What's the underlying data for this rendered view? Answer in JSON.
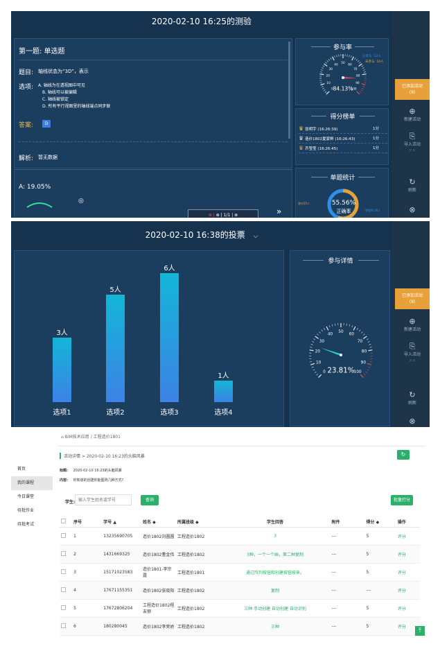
{
  "quiz": {
    "title": "2020-02-10 16:25的测验",
    "question_heading": "第一题: 单选题",
    "question_label": "题目:",
    "question_text": "轴线状态为“3D”，表示",
    "options_label": "选项:",
    "options": [
      "A. 轴线为在透视图中可见",
      "B. 轴线可以被编辑",
      "C. 轴线被锁定",
      "D. 所有平行视图里的轴线端点同步联"
    ],
    "answer_label": "答案:",
    "answer_value": "D",
    "analysis_label": "解析:",
    "analysis_value": "暂无数据",
    "stat_line": "A: 19.05%",
    "pager": "1/1",
    "participation": {
      "title": "参与率",
      "joined": "已参与: 53人",
      "not_joined": "未参与: 10人",
      "rate": "84.13%",
      "rate_value": 84.13,
      "ticks": [
        "0",
        "10",
        "20",
        "30",
        "40",
        "50",
        "60",
        "70",
        "80",
        "90",
        "100"
      ]
    },
    "leaderboard": {
      "title": "得分榜单",
      "rows": [
        {
          "name": "张明宇 (16:26:39)",
          "score": "1分"
        },
        {
          "name": "造价1802夏家鲜 (16:26:43)",
          "score": "1分"
        },
        {
          "name": "齐莹莹 (16:26:45)",
          "score": "1分"
        }
      ]
    },
    "single_stats": {
      "title": "单题统计",
      "left": "答对35人",
      "right": "答错率:26人",
      "percent": "55.56%",
      "percent_value": 55.56,
      "sub": "正确率"
    }
  },
  "rail": {
    "joined_activity": "已添加活动",
    "joined_count": "(9)",
    "new_activity": "新建活动",
    "import_activity": "导入活动",
    "refresh": "刷新",
    "close": "关闭"
  },
  "vote": {
    "title": "2020-02-10 16:38的投票",
    "dropdown_icon": "chevron-down-icon",
    "detail_title": "参与详情",
    "rate": "23.81%",
    "rate_value": 23.81,
    "bars": [
      {
        "label": "选项1",
        "count": "3人",
        "value": 3
      },
      {
        "label": "选项2",
        "count": "5人",
        "value": 5
      },
      {
        "label": "选项3",
        "count": "6人",
        "value": 6
      },
      {
        "label": "选项4",
        "count": "1人",
        "value": 1
      }
    ]
  },
  "chart_data": {
    "type": "bar",
    "categories": [
      "选项1",
      "选项2",
      "选项3",
      "选项4"
    ],
    "values": [
      3,
      5,
      6,
      1
    ],
    "title": "",
    "xlabel": "",
    "ylabel": "",
    "ylim": [
      0,
      6
    ],
    "grid": false
  },
  "web": {
    "breadcrumb_top": "BIM技术应用 / 工程造价1801",
    "side_menu": [
      "首页",
      "我的课程",
      "今日课堂",
      "待批作业",
      "待批考试"
    ],
    "breadcrumb": "活动详情 > 2020-02-10 16:23的头脑风暴",
    "title_label": "标题:",
    "title_value": "2020-02-10 16:23的头脑风暴",
    "content_label": "内容:",
    "content_value": "你知道的创建你能图则几种方式?",
    "student_label": "学生:",
    "search_placeholder": "输入学生姓名或学号",
    "search_button": "查询",
    "batch_button": "批量打分",
    "columns": [
      "序号",
      "学号 ▲",
      "姓名 ◆",
      "所属班级 ◆",
      "学生回答",
      "附件",
      "得分 ◆",
      "操作"
    ],
    "rows": [
      {
        "no": "1",
        "id": "13235690705",
        "name": "造价1802刘圆圆",
        "class": "工程造价1802",
        "answer": "3",
        "att": "---",
        "score": "5",
        "op": "评分"
      },
      {
        "no": "2",
        "id": "1431669325",
        "name": "造价1802董金伟",
        "class": "工程造价1802",
        "answer": "3种，一个一个画，第二种复制",
        "att": "---",
        "score": "5",
        "op": "评分"
      },
      {
        "no": "3",
        "id": "15171023583",
        "name": "造价1801-李宗露",
        "class": "工程造价1801",
        "answer": "通过阵列按钮和创建按钮按来。",
        "att": "---",
        "score": "5",
        "op": "评分"
      },
      {
        "no": "4",
        "id": "17671155351",
        "name": "造价1802张晓阳",
        "class": "工程造价1802",
        "answer": "复制",
        "att": "---",
        "score": "---",
        "op": "评分"
      },
      {
        "no": "5",
        "id": "17672806204",
        "name": "工程造价1802程友丽",
        "class": "工程造价1802",
        "answer": "三种 手动创建 自动创建 自动识别",
        "att": "---",
        "score": "5",
        "op": "评分"
      },
      {
        "no": "6",
        "id": "180280045",
        "name": "造价1802李荣娇",
        "class": "工程造价1802",
        "answer": "三种",
        "att": "---",
        "score": "5",
        "op": "评分"
      }
    ],
    "refresh_icon": "refresh-icon",
    "back_top_icon": "back-to-top-icon"
  },
  "colors": {
    "panel": "#15334f",
    "card": "#1b3d5e",
    "accent": "#e8a03a",
    "green": "#2bb06a",
    "bar_top": "#12b6d6",
    "bar_bottom": "#3d82e6"
  }
}
